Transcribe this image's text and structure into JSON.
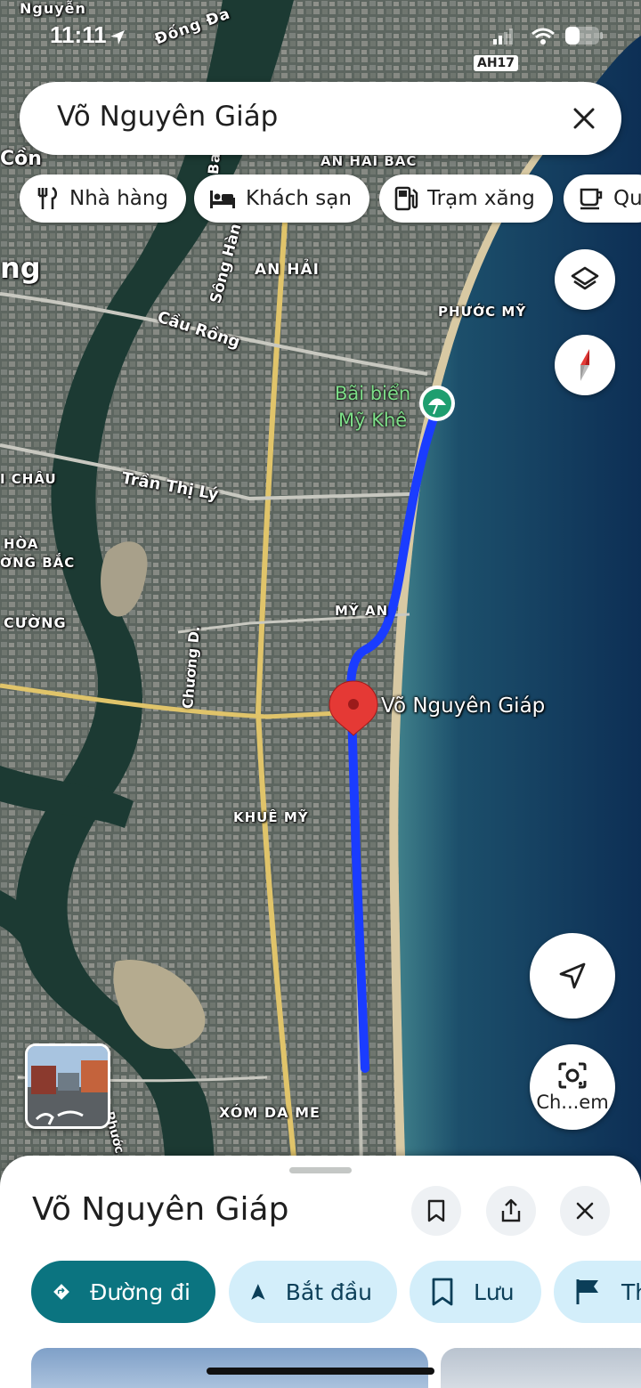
{
  "status_bar": {
    "time": "11:11"
  },
  "search": {
    "value": "Võ Nguyên Giáp"
  },
  "chips": [
    {
      "label": "Nhà hàng",
      "icon": "restaurant-icon"
    },
    {
      "label": "Khách sạn",
      "icon": "hotel-icon"
    },
    {
      "label": "Trạm xăng",
      "icon": "gas-station-icon"
    },
    {
      "label": "Qu",
      "icon": "cafe-icon"
    }
  ],
  "map": {
    "labels": {
      "nguyen": "Nguyễn",
      "dong_da": "Đống Đa",
      "ah17": "AH17",
      "con": "Cồn",
      "an_hai_bac": "AN HẢI BẮC",
      "ng": "ng",
      "ba": "Ba",
      "song_han": "Sông Hàn",
      "an_hai": "AN HẢI",
      "phuoc_my": "PHƯỚC MỸ",
      "cau_rong": "Cầu Rồng",
      "bai_bien": "Bãi biển",
      "my_khe": "Mỹ Khê",
      "i_chau": "I CHÂU",
      "tran_thi_ly": "Trần Thị Lý",
      "hoa": "HÒA",
      "ong_bac": "ỜNG BẮC",
      "cuong": "CƯỜNG",
      "my_an": "MỸ AN",
      "chuong_d": "Chương D.",
      "pin_label": "Võ Nguyên Giáp",
      "khue_my": "KHUÊ MỸ",
      "xom_da_me": "XÓM DA ME",
      "phuoc": "Phước"
    },
    "route_color": "#1a3cff",
    "pin_color": "#e53935"
  },
  "buttons": {
    "lens_label": "Ch...em"
  },
  "sheet": {
    "title": "Võ Nguyên Giáp",
    "actions": {
      "directions": "Đường đi",
      "start": "Bắt đầu",
      "save": "Lưu",
      "more": "Th"
    }
  },
  "colors": {
    "accent": "#0b7480",
    "chip_bg": "#d3eefa"
  }
}
